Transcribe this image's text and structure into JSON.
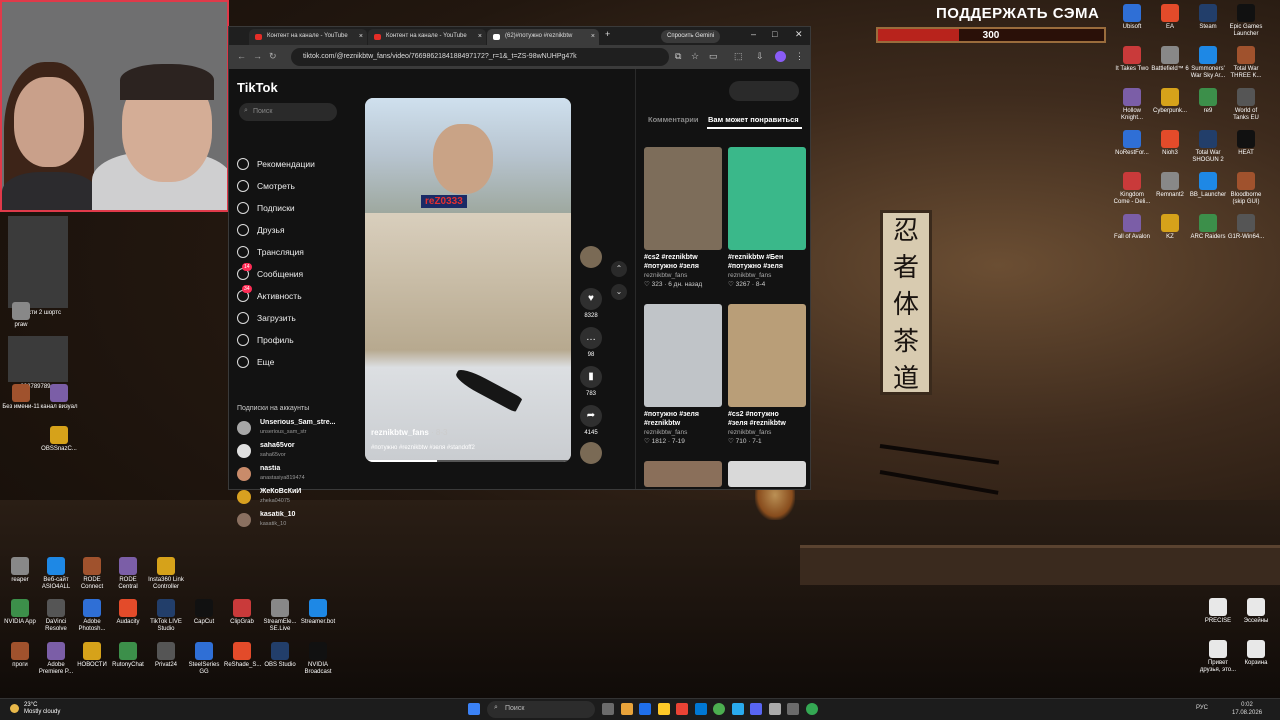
{
  "overlay": {
    "support_title": "ПОДДЕРЖАТЬ СЭМА",
    "hp_value": "300",
    "hp_fill_fraction": 0.36
  },
  "scroll_text": [
    "忍",
    "者",
    "体",
    "茶",
    "道"
  ],
  "desktop_right": [
    {
      "label": "Ubisoft"
    },
    {
      "label": "EA"
    },
    {
      "label": "Steam"
    },
    {
      "label": "Epic Games Launcher"
    },
    {
      "label": "It Takes Two"
    },
    {
      "label": "Battlefield™ 6"
    },
    {
      "label": "Summoners' War Sky Ar..."
    },
    {
      "label": "Total War THREE K..."
    },
    {
      "label": "Hollow Knight..."
    },
    {
      "label": "Cyberpunk..."
    },
    {
      "label": "re9"
    },
    {
      "label": "World of Tanks EU"
    },
    {
      "label": "NoRestFor..."
    },
    {
      "label": "Nioh3"
    },
    {
      "label": "Total War SHOGUN 2"
    },
    {
      "label": "HEAT"
    },
    {
      "label": "Kingdom Come - Deli..."
    },
    {
      "label": "Remnant2"
    },
    {
      "label": "BB_Launcher"
    },
    {
      "label": "Bloodborne (skip GUI)"
    },
    {
      "label": "Fall of Avalon"
    },
    {
      "label": "KZ"
    },
    {
      "label": "ARC Raiders"
    },
    {
      "label": "G1R-Win64..."
    }
  ],
  "desktop_left": [
    {
      "label": "новости 2"
    },
    {
      "label": "новости 2 шортс"
    },
    {
      "label": "praw"
    },
    {
      "label": "898789789..."
    },
    {
      "label": "Без имени-11"
    },
    {
      "label": "канал визуал"
    },
    {
      "label": "OBSSnazC..."
    }
  ],
  "desktop_bottom": [
    {
      "label": "reaper"
    },
    {
      "label": "Веб-сайт ASIO4ALL"
    },
    {
      "label": "RODE Connect"
    },
    {
      "label": "RODE Central"
    },
    {
      "label": "Insta360 Link Controller"
    },
    {
      "label": "NVIDIA App"
    },
    {
      "label": "DaVinci Resolve"
    },
    {
      "label": "Adobe Photosh..."
    },
    {
      "label": "Audacity"
    },
    {
      "label": "TikTok LIVE Studio"
    },
    {
      "label": "CapCut"
    },
    {
      "label": "ClipGrab"
    },
    {
      "label": "StreamEle... SE.Live"
    },
    {
      "label": "Streamer.bot"
    },
    {
      "label": "проги"
    },
    {
      "label": "Adobe Premiere P..."
    },
    {
      "label": "НОВОСТИ"
    },
    {
      "label": "RutonyChat"
    },
    {
      "label": "Privat24"
    },
    {
      "label": "SteelSeries GG"
    },
    {
      "label": "ReShade_S..."
    },
    {
      "label": "OBS Studio"
    },
    {
      "label": "NVIDIA Broadcast"
    }
  ],
  "desktop_right_bottom": [
    {
      "label": "PRECISE"
    },
    {
      "label": "Эссейны"
    },
    {
      "label": "Привет друзья, это..."
    },
    {
      "label": "Корзина"
    }
  ],
  "browser": {
    "tabs": [
      {
        "label": "Контент на канале - YouTube"
      },
      {
        "label": "Контент на канале - YouTube"
      },
      {
        "label": "(62)#потужно #reznikbtw"
      }
    ],
    "new_tab": "+",
    "gemini": "Спросить Gemini",
    "url": "tiktok.com/@reznikbtw_fans/video/7669862184188497172?_r=1&_t=ZS-98wNUHPg47k"
  },
  "tiktok": {
    "logo": "TikTok",
    "search_placeholder": "Поиск",
    "menu": [
      {
        "label": "Рекомендации",
        "icon": "home-icon"
      },
      {
        "label": "Смотреть",
        "icon": "compass-icon"
      },
      {
        "label": "Подписки",
        "icon": "following-icon"
      },
      {
        "label": "Друзья",
        "icon": "friends-icon"
      },
      {
        "label": "Трансляция",
        "icon": "live-icon"
      },
      {
        "label": "Сообщения",
        "icon": "messages-icon",
        "badge": "14"
      },
      {
        "label": "Активность",
        "icon": "activity-icon",
        "badge": "34"
      },
      {
        "label": "Загрузить",
        "icon": "upload-icon"
      },
      {
        "label": "Профиль",
        "icon": "profile-icon"
      },
      {
        "label": "Еще",
        "icon": "more-icon"
      }
    ],
    "subs_title": "Подписки на аккаунты",
    "subs": [
      {
        "name": "Unserious_Sam_stre...",
        "handle": "unserious_sam_str"
      },
      {
        "name": "saha65vor",
        "handle": "saha65vor"
      },
      {
        "name": "nastia",
        "handle": "anastasiya819474"
      },
      {
        "name": "ЖеКоВсКиЙ",
        "handle": "zheka04075"
      },
      {
        "name": "kasatik_10",
        "handle": "kasatik_10"
      }
    ],
    "video": {
      "streamer_nick": "reZ0333",
      "author": "reznikbtw_fans",
      "date": "· 8-3",
      "tags": "#потужно #reznikbtw #зеля #standoff2",
      "progress_fraction": 0.35
    },
    "actions": [
      {
        "icon": "plus-icon",
        "count": ""
      },
      {
        "icon": "heart-icon",
        "count": "8328"
      },
      {
        "icon": "comment-icon",
        "count": "98"
      },
      {
        "icon": "bookmark-icon",
        "count": "783"
      },
      {
        "icon": "share-icon",
        "count": "4145"
      }
    ],
    "right_tabs": [
      "Комментарии",
      "Вам может понравиться"
    ],
    "cards": [
      {
        "caption": "#cs2 #reznikbtw",
        "caption2": "#потужно #зеля",
        "author": "reznikbtw_fans",
        "stats": "♡ 323 · 6 дн. назад"
      },
      {
        "caption": "#reznikbtw #Бен",
        "caption2": "#потужно #зеля",
        "author": "reznikbtw_fans",
        "stats": "♡ 3267 · 8-4"
      },
      {
        "caption": "#потужно #зеля",
        "caption2": "#reznikbtw",
        "author": "reznikbtw_fans",
        "stats": "♡ 1812 · 7-19"
      },
      {
        "caption": "#cs2 #потужно",
        "caption2": "#зеля #reznikbtw",
        "author": "reznikbtw_fans",
        "stats": "♡ 710 · 7-1"
      }
    ]
  },
  "taskbar": {
    "weather_temp": "23°C",
    "weather_desc": "Mostly cloudy",
    "search": "Поиск",
    "lang": "РУС",
    "time": "0:02",
    "date": "17.08.2026"
  }
}
